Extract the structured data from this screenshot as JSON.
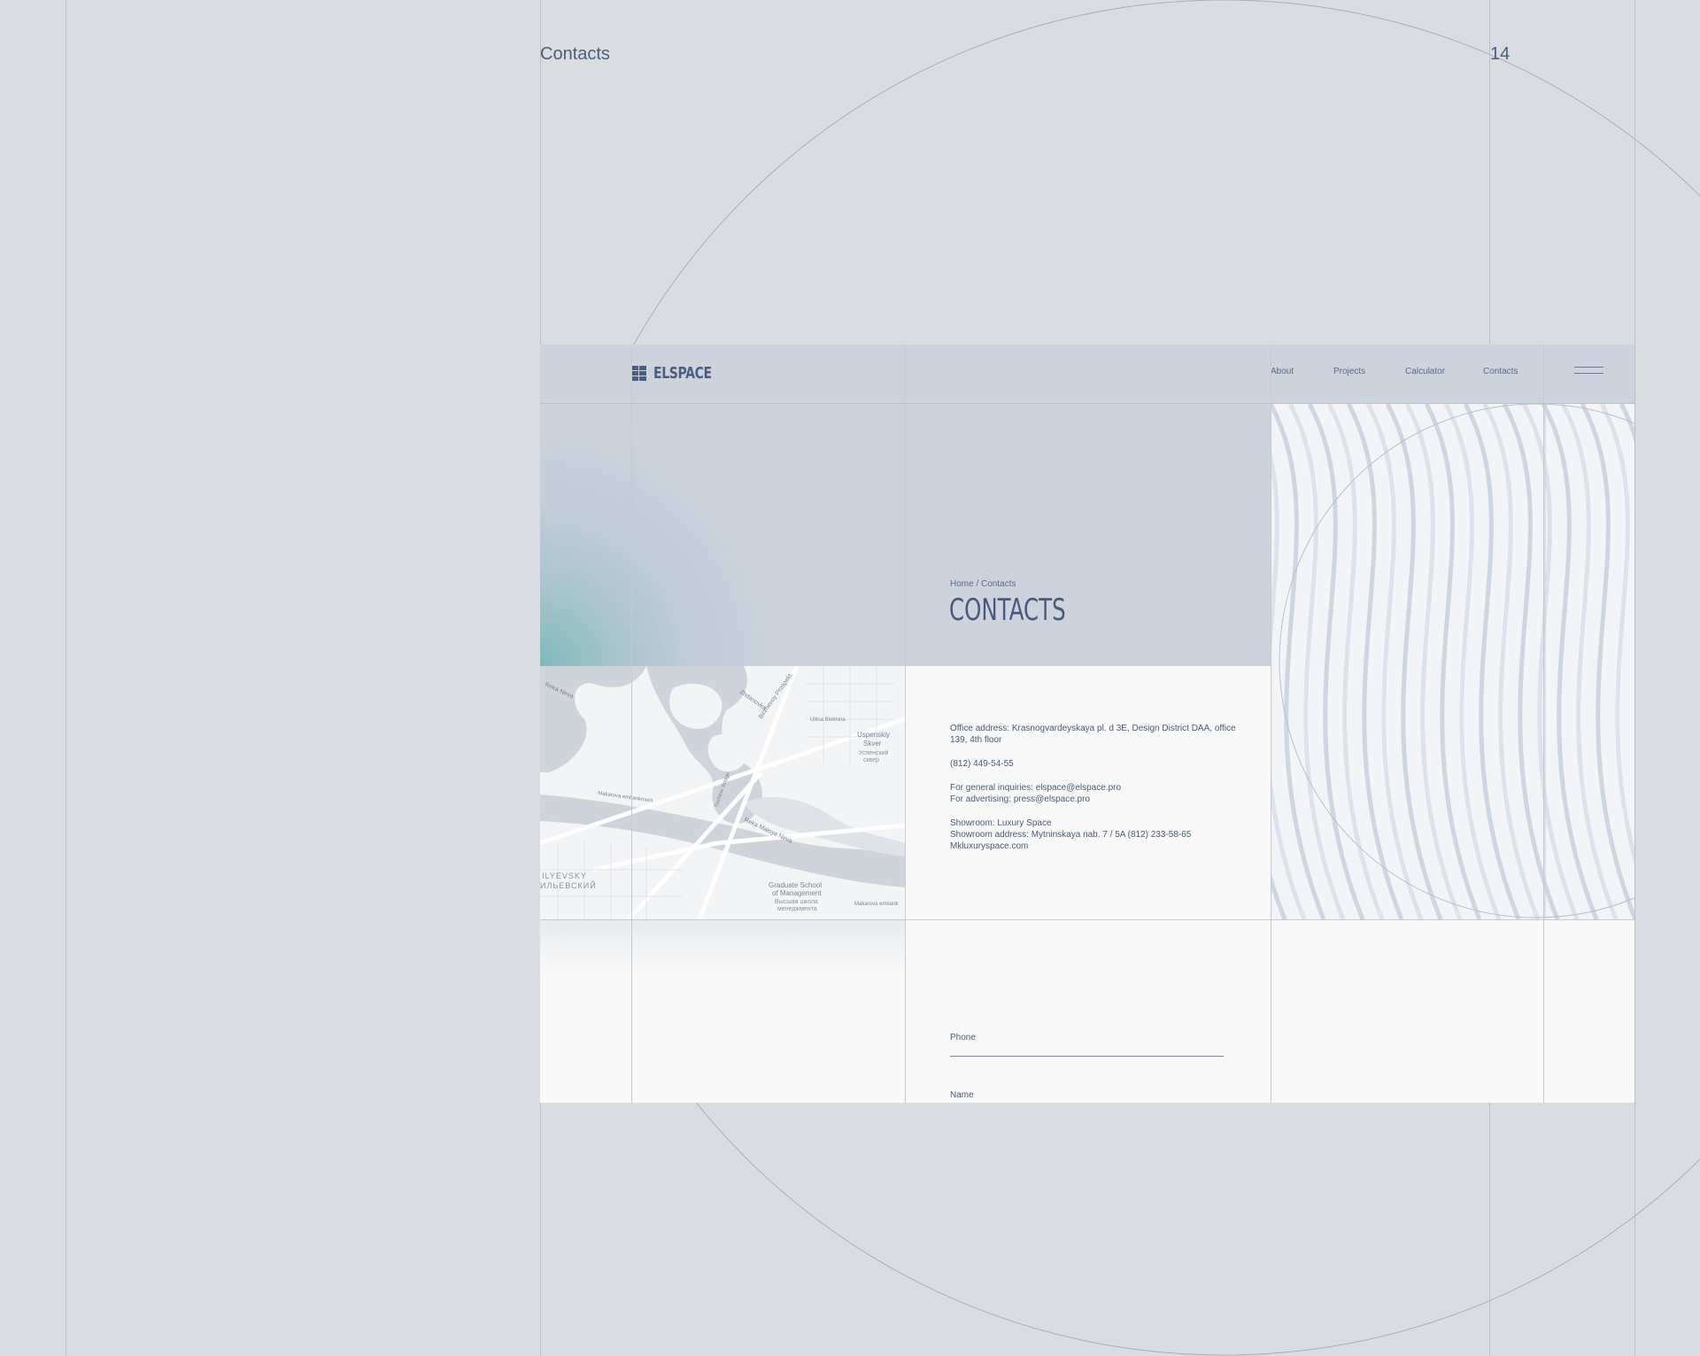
{
  "slide": {
    "section_title": "Contacts",
    "page_number": "14"
  },
  "header": {
    "logo_text": "ELSPACE",
    "nav": [
      "About",
      "Projects",
      "Calculator",
      "Contacts"
    ],
    "menu_icon": "hamburger-icon"
  },
  "hero": {
    "breadcrumb": "Home / Contacts",
    "title": "CONTACTS"
  },
  "contacts": {
    "office_address_line1": "Office address: Krasnogvardeyskaya pl. d 3E, Design District DAA, office",
    "office_address_line2": "139, 4th floor",
    "phone": "(812) 449-54-55",
    "general_inquiries": "For general inquiries: elspace@elspace.pro",
    "advertising": "For advertising: press@elspace.pro",
    "showroom": "Showroom: Luxury Space",
    "showroom_address": "Showroom address: Mytninskaya nab. 7 / 5A (812) 233-58-65",
    "showroom_site": "Mkluxuryspace.com"
  },
  "map": {
    "labels": [
      "Reka Neva",
      "Zhdanovka",
      "Birzhevoy Prospekt",
      "Uspenskiy Skver",
      "Успенский сквер",
      "Ulitsa Blokhina",
      "Reka Maloya Neva",
      "Tuchkov Bridge",
      "Makarova embankment",
      "Graduate School of Management",
      "Высшая школа менеджмента",
      "ILYEVSKY",
      "ИЛЬЕВСКИЙ",
      "Syezdovskaya",
      "Zverinskaya Ulitsa",
      "Dobrolyubova"
    ]
  },
  "form": {
    "phone_label": "Phone",
    "name_label": "Name"
  },
  "colors": {
    "background": "#d9dde2",
    "header": "#cdd3dd",
    "accent_teal": "#7fb9bd",
    "text": "#4a5a78",
    "input_line": "#7c7fb0"
  }
}
